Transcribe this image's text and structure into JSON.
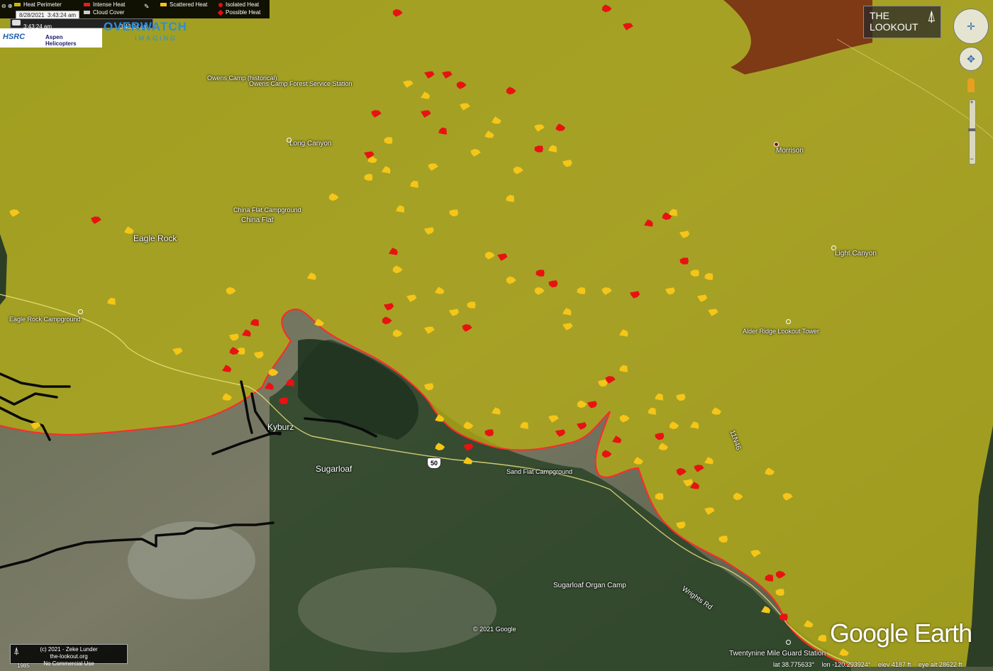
{
  "legend": {
    "items": [
      {
        "label": "Heat Perimeter",
        "color": "#c8b800"
      },
      {
        "label": "Intense Heat",
        "color": "#e02020"
      },
      {
        "label": "Cloud Cover",
        "color": "#cccccc"
      },
      {
        "label": "Scattered Heat",
        "color": "#f5c518"
      },
      {
        "label": "Isolated Heat",
        "color": "#e01010"
      },
      {
        "label": "Possible Heat",
        "color": "#e01010"
      }
    ],
    "date": "8/28/2021",
    "time": "3:43:24 am",
    "slider_start": "3:43:24 am",
    "slider_end": "3:43:24 am"
  },
  "branding": {
    "logo1": "HSRC",
    "logo2": "Aspen Helicopters",
    "overwatch": "OVERWATCH",
    "overwatch_sub": "IMAGING",
    "lookout_line1": "THE",
    "lookout_line2": "LOOKOUT",
    "google_earth": "Google Earth",
    "copyright": "© 2021 Google",
    "credit_line1": "(c) 2021 - Zeke Lunder",
    "credit_line2": "the-lookout.org",
    "credit_line3": "No Commercial Use",
    "credit_year": "1985"
  },
  "places": {
    "owens_camp": "Owens Camp (historical)",
    "owens_station": "Owens Camp Forest Service Station",
    "long_canyon": "Long Canyon",
    "morrison": "Morrison",
    "china_flat_cg": "China Flat Campground",
    "china_flat": "China Flat",
    "eagle_rock": "Eagle Rock",
    "light_canyon": "Light Canyon",
    "eagle_rock_cg": "Eagle Rock Campground",
    "alder_ridge": "Alder Ridge Lookout Tower",
    "kyburz": "Kyburz",
    "sugarloaf": "Sugarloaf",
    "hwy": "50",
    "sand_flat": "Sand Flat Campground",
    "road_11n46": "11N46",
    "sugarloaf_organ": "Sugarloaf Organ Camp",
    "wrights_rd": "Wrights Rd",
    "twentynine": "Twentynine Mile Guard Station"
  },
  "status": {
    "lat": "lat  38.775633°",
    "lon": "lon -120.293924°",
    "elev": "elev  4187 ft",
    "eye": "eye alt  28622 ft"
  },
  "colors": {
    "perimeter_fill": "#b4ad14",
    "perimeter_line": "#ff2a2a",
    "scattered": "#f5c518",
    "isolated": "#e81212",
    "forest": "#2f4a2a",
    "terrain": "#6e7460",
    "burned": "#7a2e14"
  },
  "heat": {
    "scattered": [
      [
        548,
        198
      ],
      [
        575,
        118
      ],
      [
        600,
        135
      ],
      [
        655,
        150
      ],
      [
        690,
        190
      ],
      [
        610,
        235
      ],
      [
        585,
        260
      ],
      [
        640,
        300
      ],
      [
        565,
        295
      ],
      [
        605,
        325
      ],
      [
        690,
        360
      ],
      [
        560,
        380
      ],
      [
        580,
        420
      ],
      [
        620,
        410
      ],
      [
        640,
        440
      ],
      [
        665,
        430
      ],
      [
        605,
        465
      ],
      [
        560,
        470
      ],
      [
        720,
        395
      ],
      [
        760,
        410
      ],
      [
        800,
        440
      ],
      [
        820,
        410
      ],
      [
        855,
        410
      ],
      [
        880,
        470
      ],
      [
        950,
        300
      ],
      [
        965,
        330
      ],
      [
        980,
        385
      ],
      [
        945,
        410
      ],
      [
        1000,
        390
      ],
      [
        990,
        420
      ],
      [
        1005,
        440
      ],
      [
        800,
        460
      ],
      [
        720,
        280
      ],
      [
        730,
        240
      ],
      [
        520,
        250
      ],
      [
        470,
        278
      ],
      [
        440,
        390
      ],
      [
        325,
        410
      ],
      [
        158,
        425
      ],
      [
        182,
        325
      ],
      [
        250,
        495
      ],
      [
        320,
        560
      ],
      [
        340,
        495
      ],
      [
        365,
        500
      ],
      [
        330,
        475
      ],
      [
        385,
        525
      ],
      [
        450,
        455
      ],
      [
        605,
        545
      ],
      [
        620,
        590
      ],
      [
        660,
        600
      ],
      [
        700,
        580
      ],
      [
        740,
        600
      ],
      [
        780,
        590
      ],
      [
        820,
        570
      ],
      [
        850,
        540
      ],
      [
        880,
        590
      ],
      [
        920,
        580
      ],
      [
        950,
        600
      ],
      [
        980,
        600
      ],
      [
        1010,
        580
      ],
      [
        900,
        650
      ],
      [
        930,
        700
      ],
      [
        960,
        740
      ],
      [
        1000,
        720
      ],
      [
        1040,
        700
      ],
      [
        1065,
        780
      ],
      [
        1085,
        665
      ],
      [
        1110,
        700
      ],
      [
        1020,
        760
      ],
      [
        935,
        630
      ],
      [
        1000,
        650
      ],
      [
        880,
        520
      ],
      [
        960,
        560
      ],
      [
        1080,
        860
      ],
      [
        1100,
        835
      ],
      [
        1140,
        880
      ],
      [
        1160,
        900
      ],
      [
        1190,
        920
      ],
      [
        20,
        300
      ],
      [
        50,
        600
      ],
      [
        660,
        650
      ],
      [
        620,
        630
      ],
      [
        760,
        180
      ],
      [
        780,
        210
      ],
      [
        800,
        230
      ],
      [
        670,
        215
      ],
      [
        700,
        170
      ],
      [
        525,
        225
      ],
      [
        545,
        240
      ],
      [
        930,
        560
      ],
      [
        970,
        680
      ]
    ],
    "isolated": [
      [
        530,
        160
      ],
      [
        560,
        18
      ],
      [
        605,
        105
      ],
      [
        630,
        105
      ],
      [
        650,
        120
      ],
      [
        720,
        128
      ],
      [
        600,
        160
      ],
      [
        625,
        185
      ],
      [
        760,
        210
      ],
      [
        790,
        180
      ],
      [
        520,
        218
      ],
      [
        555,
        355
      ],
      [
        708,
        362
      ],
      [
        762,
        385
      ],
      [
        780,
        400
      ],
      [
        895,
        415
      ],
      [
        965,
        368
      ],
      [
        915,
        315
      ],
      [
        940,
        305
      ],
      [
        548,
        432
      ],
      [
        545,
        452
      ],
      [
        658,
        462
      ],
      [
        360,
        455
      ],
      [
        330,
        495
      ],
      [
        320,
        520
      ],
      [
        348,
        470
      ],
      [
        135,
        310
      ],
      [
        380,
        545
      ],
      [
        410,
        540
      ],
      [
        400,
        565
      ],
      [
        660,
        630
      ],
      [
        690,
        610
      ],
      [
        790,
        610
      ],
      [
        820,
        600
      ],
      [
        860,
        535
      ],
      [
        835,
        570
      ],
      [
        870,
        620
      ],
      [
        855,
        640
      ],
      [
        930,
        615
      ],
      [
        960,
        665
      ],
      [
        985,
        660
      ],
      [
        980,
        685
      ],
      [
        1100,
        810
      ],
      [
        1085,
        815
      ],
      [
        1105,
        870
      ],
      [
        855,
        12
      ],
      [
        885,
        37
      ]
    ]
  }
}
